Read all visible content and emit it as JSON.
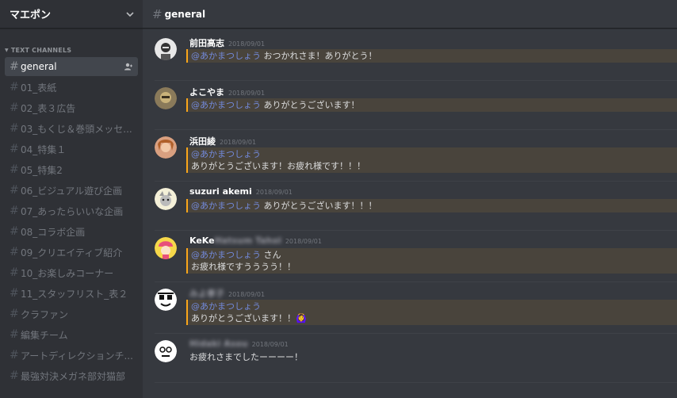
{
  "server": {
    "name": "マエポン"
  },
  "category": "TEXT CHANNELS",
  "channels": [
    {
      "name": "general"
    },
    {
      "name": "01_表紙"
    },
    {
      "name": "02_表３広告"
    },
    {
      "name": "03_もくじ＆巻頭メッセ..."
    },
    {
      "name": "04_特集１"
    },
    {
      "name": "05_特集2"
    },
    {
      "name": "06_ビジュアル遊び企画"
    },
    {
      "name": "07_あったらいいな企画"
    },
    {
      "name": "08_コラボ企画"
    },
    {
      "name": "09_クリエイティブ紹介"
    },
    {
      "name": "10_お楽しみコーナー"
    },
    {
      "name": "11_スタッフリスト_表２"
    },
    {
      "name": "クラファン"
    },
    {
      "name": "編集チーム"
    },
    {
      "name": "アートディレクションチ..."
    },
    {
      "name": "最強対決メガネ部対猫部"
    }
  ],
  "topbar": {
    "hash": "#",
    "title": "general"
  },
  "messages": [
    {
      "user": "前田高志",
      "time": "2018/09/01",
      "mention": "@あかまつしょう",
      "text1": " おつかれさま！ありがとう！",
      "text2": ""
    },
    {
      "user": "よこやま",
      "time": "2018/09/01",
      "mention": "@あかまつしょう",
      "text1": " ありがとうございます！",
      "text2": ""
    },
    {
      "user": "浜田綾",
      "time": "2018/09/01",
      "mention": "@あかまつしょう",
      "text1": "",
      "text2": "ありがとうございます！お疲れ様です！！！"
    },
    {
      "user": "suzuri akemi",
      "time": "2018/09/01",
      "mention": "@あかまつしょう",
      "text1": " ありがとうございます！！！",
      "text2": ""
    },
    {
      "user": "KeKe",
      "time": "2018/09/01",
      "mention": "@あかまつしょう",
      "text1": " さん",
      "text2": "お疲れ様ですうううう！！"
    },
    {
      "user": "",
      "time": "2018/09/01",
      "mention": "@あかまつしょう",
      "text1": "",
      "text2": "ありがとうございます！！",
      "emoji": "🙆‍♀️"
    },
    {
      "user": "",
      "time": "2018/09/01",
      "mention": "",
      "text1": "",
      "text2": "お疲れさまでしたーーーー！"
    }
  ],
  "icons": {
    "chevron": "chevron-down-icon",
    "add_user": "add-user-icon"
  },
  "colors": {
    "sidebar": "#2f3136",
    "main": "#36393f",
    "mention_bg": "#49443c",
    "mention_bar": "#faa61a",
    "mention_text": "#7289da"
  }
}
